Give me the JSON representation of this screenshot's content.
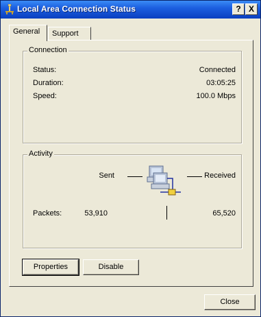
{
  "window": {
    "title": "Local Area Connection Status",
    "help_button": "?",
    "close_button": "X"
  },
  "tabs": [
    {
      "label": "General",
      "selected": true
    },
    {
      "label": "Support",
      "selected": false
    }
  ],
  "connection": {
    "legend": "Connection",
    "rows": [
      {
        "label": "Status:",
        "value": "Connected"
      },
      {
        "label": "Duration:",
        "value": "03:05:25"
      },
      {
        "label": "Speed:",
        "value": "100.0 Mbps"
      }
    ]
  },
  "activity": {
    "legend": "Activity",
    "sent_label": "Sent",
    "received_label": "Received",
    "packets_label": "Packets:",
    "packets_sent": "53,910",
    "packets_received": "65,520"
  },
  "buttons": {
    "properties": "Properties",
    "disable": "Disable",
    "close": "Close"
  },
  "icons": {
    "title_icon": "network-connection-icon",
    "activity_icon": "network-computers-icon"
  }
}
